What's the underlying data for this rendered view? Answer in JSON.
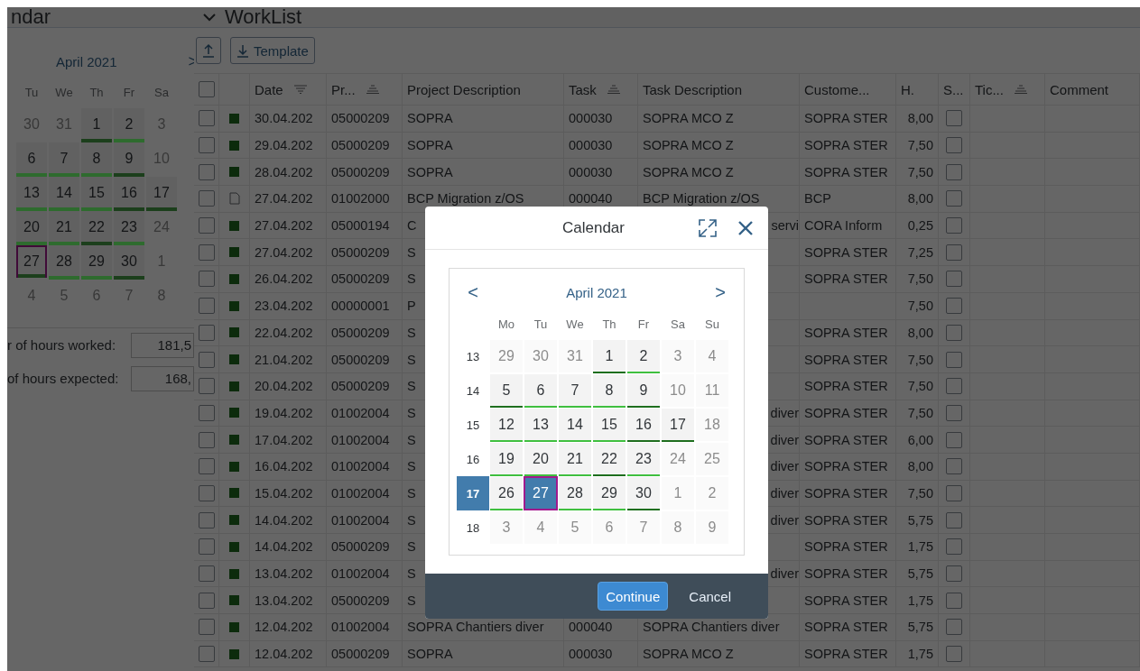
{
  "left_panel": {
    "title": "ndar",
    "calendar": {
      "month": "April 2021",
      "next": ">",
      "weekdays": [
        "Tu",
        "We",
        "Th",
        "Fr",
        "Sa"
      ],
      "weeks": [
        [
          {
            "day": "30",
            "today": false
          },
          {
            "day": "31",
            "today": false
          },
          {
            "day": "1",
            "color": "#1c3f1c",
            "today": false
          },
          {
            "day": "2",
            "color": "#2e6b2e",
            "today": false
          },
          {
            "day": "3",
            "today": false
          }
        ],
        [
          {
            "day": "6",
            "color": "#2e6b2e",
            "today": false
          },
          {
            "day": "7",
            "color": "#2e6b2e",
            "today": false
          },
          {
            "day": "8",
            "color": "#2e6b2e",
            "today": false
          },
          {
            "day": "9",
            "color": "#1c3f1c",
            "today": false
          },
          {
            "day": "10",
            "today": false
          }
        ],
        [
          {
            "day": "13",
            "color": "#2e6b2e",
            "today": false
          },
          {
            "day": "14",
            "color": "#2e6b2e",
            "today": false
          },
          {
            "day": "15",
            "color": "#2e6b2e",
            "today": false
          },
          {
            "day": "16",
            "color": "#1c3f1c",
            "today": false
          },
          {
            "day": "17",
            "color": "#1c3f1c",
            "today": false
          }
        ],
        [
          {
            "day": "20",
            "color": "#2e6b2e",
            "today": false
          },
          {
            "day": "21",
            "color": "#2e6b2e",
            "today": false
          },
          {
            "day": "22",
            "color": "#1c3f1c",
            "today": false
          },
          {
            "day": "23",
            "color": "#2e6b2e",
            "today": false
          },
          {
            "day": "24",
            "today": false
          }
        ],
        [
          {
            "day": "27",
            "color": "#1c3f1c",
            "today": true
          },
          {
            "day": "28",
            "color": "#2e6b2e",
            "today": false
          },
          {
            "day": "29",
            "color": "#2e6b2e",
            "today": false
          },
          {
            "day": "30",
            "color": "#1c3f1c",
            "today": false
          },
          {
            "day": "1",
            "today": false
          }
        ],
        [
          {
            "day": "4",
            "today": false
          },
          {
            "day": "5",
            "today": false
          },
          {
            "day": "6",
            "today": false
          },
          {
            "day": "7",
            "today": false
          },
          {
            "day": "8",
            "today": false
          }
        ]
      ]
    },
    "totals": [
      {
        "label": "r of hours worked:",
        "value": "181,5"
      },
      {
        "label": "of hours expected:",
        "value": "168,"
      }
    ]
  },
  "worklist": {
    "title": "WorkList",
    "toolbar": [
      {
        "kind": "upload"
      },
      {
        "kind": "download",
        "label": "Template"
      }
    ],
    "columns": [
      {
        "kind": "select",
        "checked": false
      },
      {
        "kind": "status"
      },
      {
        "kind": "filtered",
        "label": "Date"
      },
      {
        "kind": "sortable",
        "label": "Pr..."
      },
      {
        "kind": "text",
        "label": "Project Description"
      },
      {
        "kind": "sortable",
        "label": "Task"
      },
      {
        "kind": "text",
        "label": "Task Description"
      },
      {
        "kind": "text",
        "label": "Custome..."
      },
      {
        "kind": "text",
        "label": "H."
      },
      {
        "kind": "text",
        "label": "S..."
      },
      {
        "kind": "sortable",
        "label": "Tic..."
      },
      {
        "kind": "text",
        "label": "Comment"
      }
    ],
    "rows": [
      {
        "checked": false,
        "kind": "done",
        "date": "30.04.202",
        "project": "05000209",
        "project_description": "SOPRA",
        "task": "000030",
        "task_description": "SOPRA MCO Z",
        "customer": "SOPRA STER",
        "hours": "8,00",
        "column_10_checked": false
      },
      {
        "checked": false,
        "kind": "done",
        "date": "29.04.202",
        "project": "05000209",
        "project_description": "SOPRA",
        "task": "000030",
        "task_description": "SOPRA MCO Z",
        "customer": "SOPRA STER",
        "hours": "7,50",
        "column_10_checked": false
      },
      {
        "checked": false,
        "kind": "done",
        "date": "28.04.202",
        "project": "05000209",
        "project_description": "SOPRA",
        "task": "000030",
        "task_description": "SOPRA MCO Z",
        "customer": "SOPRA STER",
        "hours": "7,50",
        "column_10_checked": false
      },
      {
        "checked": false,
        "kind": "draft",
        "date": "27.04.202",
        "project": "01002000",
        "project_description": "BCP Migration z/OS",
        "task": "000040",
        "task_description": "BCP Migration z/OS",
        "customer": "BCP",
        "hours": "8,00",
        "column_10_checked": false
      },
      {
        "checked": false,
        "kind": "done",
        "date": "27.04.202",
        "project": "05000194",
        "project_description": "C",
        "task_description": "servi",
        "task_description_clipped": true,
        "customer": "CORA Inform",
        "hours": "0,25",
        "column_10_checked": false
      },
      {
        "checked": false,
        "kind": "done",
        "date": "27.04.202",
        "project": "05000209",
        "project_description": "S",
        "customer": "SOPRA STER",
        "hours": "7,25",
        "column_10_checked": false
      },
      {
        "checked": false,
        "kind": "done",
        "date": "26.04.202",
        "project": "05000209",
        "project_description": "S",
        "customer": "SOPRA STER",
        "hours": "7,50",
        "column_10_checked": false
      },
      {
        "checked": false,
        "kind": "done",
        "date": "23.04.202",
        "project": "00000001",
        "project_description": "P",
        "hours": "7,50",
        "column_10_checked": false
      },
      {
        "checked": false,
        "kind": "done",
        "date": "22.04.202",
        "project": "05000209",
        "project_description": "S",
        "customer": "SOPRA STER",
        "hours": "8,00",
        "column_10_checked": false
      },
      {
        "checked": false,
        "kind": "done",
        "date": "21.04.202",
        "project": "05000209",
        "project_description": "S",
        "customer": "SOPRA STER",
        "hours": "7,50",
        "column_10_checked": false
      },
      {
        "checked": false,
        "kind": "done",
        "date": "20.04.202",
        "project": "05000209",
        "project_description": "S",
        "customer": "SOPRA STER",
        "hours": "7,50",
        "column_10_checked": false
      },
      {
        "checked": false,
        "kind": "done",
        "date": "19.04.202",
        "project": "01002004",
        "project_description": "S",
        "task_description": "diver",
        "task_description_clipped": true,
        "customer": "SOPRA STER",
        "hours": "7,50",
        "column_10_checked": false
      },
      {
        "checked": false,
        "kind": "done",
        "date": "17.04.202",
        "project": "01002004",
        "project_description": "S",
        "task_description": "diver",
        "task_description_clipped": true,
        "customer": "SOPRA STER",
        "hours": "6,00",
        "column_10_checked": false
      },
      {
        "checked": false,
        "kind": "done",
        "date": "16.04.202",
        "project": "01002004",
        "project_description": "S",
        "task_description": "diver",
        "task_description_clipped": true,
        "customer": "SOPRA STER",
        "hours": "8,00",
        "column_10_checked": false
      },
      {
        "checked": false,
        "kind": "done",
        "date": "15.04.202",
        "project": "01002004",
        "project_description": "S",
        "task_description": "diver",
        "task_description_clipped": true,
        "customer": "SOPRA STER",
        "hours": "7,50",
        "column_10_checked": false
      },
      {
        "checked": false,
        "kind": "done",
        "date": "14.04.202",
        "project": "01002004",
        "project_description": "S",
        "task_description": "diver",
        "task_description_clipped": true,
        "customer": "SOPRA STER",
        "hours": "5,75",
        "column_10_checked": false
      },
      {
        "checked": false,
        "kind": "done",
        "date": "14.04.202",
        "project": "05000209",
        "project_description": "S",
        "customer": "SOPRA STER",
        "hours": "1,75",
        "column_10_checked": false
      },
      {
        "checked": false,
        "kind": "done",
        "date": "13.04.202",
        "project": "01002004",
        "project_description": "S",
        "task_description": "diver",
        "task_description_clipped": true,
        "customer": "SOPRA STER",
        "hours": "5,75",
        "column_10_checked": false
      },
      {
        "checked": false,
        "kind": "done",
        "date": "13.04.202",
        "project": "05000209",
        "project_description": "S",
        "customer": "SOPRA STER",
        "hours": "1,75",
        "column_10_checked": false
      },
      {
        "checked": false,
        "kind": "done",
        "date": "12.04.202",
        "project": "01002004",
        "project_description": "SOPRA Chantiers diver",
        "task": "000040",
        "task_description": "SOPRA Chantiers diver",
        "customer": "SOPRA STER",
        "hours": "5,75",
        "column_10_checked": false
      },
      {
        "checked": false,
        "kind": "done",
        "date": "12.04.202",
        "project": "05000209",
        "project_description": "SOPRA",
        "task": "000030",
        "task_description": "SOPRA MCO Z",
        "customer": "SOPRA STER",
        "hours": "1,75",
        "column_10_checked": false
      }
    ]
  },
  "dialog": {
    "title": "Calendar",
    "calendar": {
      "prev": "<",
      "month": "April 2021",
      "next": ">",
      "weekdays": [
        "Mo",
        "Tu",
        "We",
        "Th",
        "Fr",
        "Sa",
        "Su"
      ],
      "weeks": [
        {
          "label": "13",
          "selected": false,
          "days": [
            {
              "day": "29",
              "selected": false,
              "today": false
            },
            {
              "day": "30",
              "selected": false,
              "today": false
            },
            {
              "day": "31",
              "selected": false,
              "today": false
            },
            {
              "day": "1",
              "color": "#1e6e1e",
              "selected": false,
              "today": false
            },
            {
              "day": "2",
              "color": "#3fbf3f",
              "selected": false,
              "today": false
            },
            {
              "day": "3",
              "selected": false,
              "today": false
            },
            {
              "day": "4",
              "selected": false,
              "today": false
            }
          ]
        },
        {
          "label": "14",
          "selected": false,
          "days": [
            {
              "day": "5",
              "color": "#1e6e1e",
              "selected": false,
              "today": false
            },
            {
              "day": "6",
              "color": "#3fbf3f",
              "selected": false,
              "today": false
            },
            {
              "day": "7",
              "color": "#3fbf3f",
              "selected": false,
              "today": false
            },
            {
              "day": "8",
              "color": "#3fbf3f",
              "selected": false,
              "today": false
            },
            {
              "day": "9",
              "color": "#1e6e1e",
              "selected": false,
              "today": false
            },
            {
              "day": "10",
              "selected": false,
              "today": false
            },
            {
              "day": "11",
              "selected": false,
              "today": false
            }
          ]
        },
        {
          "label": "15",
          "selected": false,
          "days": [
            {
              "day": "12",
              "color": "#3fbf3f",
              "selected": false,
              "today": false
            },
            {
              "day": "13",
              "color": "#3fbf3f",
              "selected": false,
              "today": false
            },
            {
              "day": "14",
              "color": "#3fbf3f",
              "selected": false,
              "today": false
            },
            {
              "day": "15",
              "color": "#3fbf3f",
              "selected": false,
              "today": false
            },
            {
              "day": "16",
              "color": "#1e6e1e",
              "selected": false,
              "today": false
            },
            {
              "day": "17",
              "color": "#1e6e1e",
              "selected": false,
              "today": false
            },
            {
              "day": "18",
              "selected": false,
              "today": false
            }
          ]
        },
        {
          "label": "16",
          "selected": false,
          "days": [
            {
              "day": "19",
              "color": "#3fbf3f",
              "selected": false,
              "today": false
            },
            {
              "day": "20",
              "color": "#3fbf3f",
              "selected": false,
              "today": false
            },
            {
              "day": "21",
              "color": "#3fbf3f",
              "selected": false,
              "today": false
            },
            {
              "day": "22",
              "color": "#1e6e1e",
              "selected": false,
              "today": false
            },
            {
              "day": "23",
              "color": "#3fbf3f",
              "selected": false,
              "today": false
            },
            {
              "day": "24",
              "selected": false,
              "today": false
            },
            {
              "day": "25",
              "selected": false,
              "today": false
            }
          ]
        },
        {
          "label": "17",
          "selected": true,
          "days": [
            {
              "day": "26",
              "color": "#3fbf3f",
              "selected": false,
              "today": false
            },
            {
              "day": "27",
              "selected": true,
              "today": true
            },
            {
              "day": "28",
              "color": "#3fbf3f",
              "selected": false,
              "today": false
            },
            {
              "day": "29",
              "color": "#3fbf3f",
              "selected": false,
              "today": false
            },
            {
              "day": "30",
              "color": "#1e6e1e",
              "selected": false,
              "today": false
            },
            {
              "day": "1",
              "selected": false,
              "today": false
            },
            {
              "day": "2",
              "selected": false,
              "today": false
            }
          ]
        },
        {
          "label": "18",
          "selected": false,
          "days": [
            {
              "day": "3",
              "selected": false,
              "today": false
            },
            {
              "day": "4",
              "selected": false,
              "today": false
            },
            {
              "day": "5",
              "selected": false,
              "today": false
            },
            {
              "day": "6",
              "selected": false,
              "today": false
            },
            {
              "day": "7",
              "selected": false,
              "today": false
            },
            {
              "day": "8",
              "selected": false,
              "today": false
            },
            {
              "day": "9",
              "selected": false,
              "today": false
            }
          ]
        }
      ]
    },
    "buttons": [
      {
        "kind": "primary",
        "label": "Continue"
      },
      {
        "kind": "plain",
        "label": "Cancel"
      }
    ]
  }
}
